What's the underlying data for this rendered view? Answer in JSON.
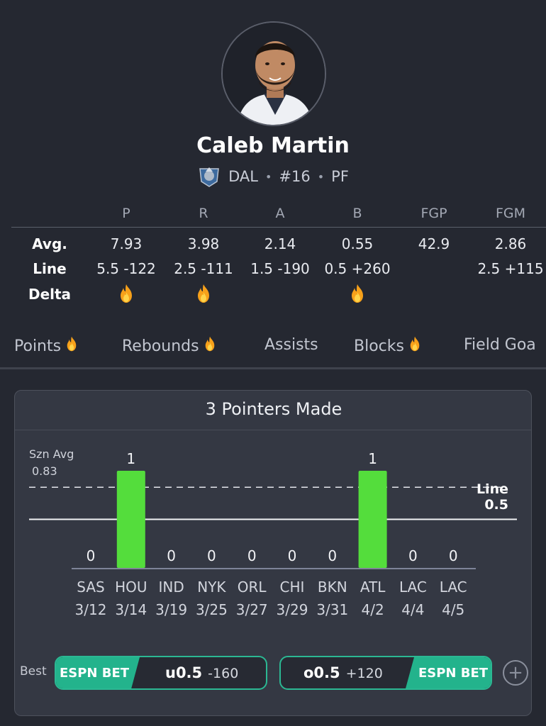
{
  "player": {
    "name": "Caleb Martin",
    "team": "DAL",
    "number": "#16",
    "position": "PF"
  },
  "stats": {
    "columns": [
      "P",
      "R",
      "A",
      "B",
      "FGP",
      "FGM"
    ],
    "rows": {
      "avg": {
        "label": "Avg.",
        "values": [
          "7.93",
          "3.98",
          "2.14",
          "0.55",
          "42.9",
          "2.86"
        ]
      },
      "line": {
        "label": "Line",
        "values": [
          "5.5 -122",
          "2.5 -111",
          "1.5 -190",
          "0.5 +260",
          "",
          "2.5 +115"
        ]
      },
      "delta": {
        "label": "Delta",
        "fire": [
          true,
          true,
          false,
          true,
          false,
          false
        ]
      }
    }
  },
  "tabs": [
    {
      "label": "Points",
      "fire": true
    },
    {
      "label": "Rebounds",
      "fire": true
    },
    {
      "label": "Assists",
      "fire": false
    },
    {
      "label": "Blocks",
      "fire": true
    },
    {
      "label": "Field Goa",
      "fire": false
    }
  ],
  "card": {
    "title": "3 Pointers Made",
    "szn_avg_label": "Szn Avg",
    "szn_avg_value": "0.83",
    "line_label": "Line",
    "line_value": "0.5"
  },
  "chart_data": {
    "type": "bar",
    "title": "3 Pointers Made",
    "categories": [
      {
        "team": "SAS",
        "date": "3/12"
      },
      {
        "team": "HOU",
        "date": "3/14"
      },
      {
        "team": "IND",
        "date": "3/19"
      },
      {
        "team": "NYK",
        "date": "3/25"
      },
      {
        "team": "ORL",
        "date": "3/27"
      },
      {
        "team": "CHI",
        "date": "3/29"
      },
      {
        "team": "BKN",
        "date": "3/31"
      },
      {
        "team": "ATL",
        "date": "4/2"
      },
      {
        "team": "LAC",
        "date": "4/4"
      },
      {
        "team": "LAC",
        "date": "4/5"
      }
    ],
    "values": [
      0,
      1,
      0,
      0,
      0,
      0,
      0,
      1,
      0,
      0
    ],
    "season_average": 0.83,
    "line": 0.5,
    "ylim": [
      0,
      1
    ],
    "colors": {
      "hit": "#54dd3c",
      "axis": "#7e8498"
    }
  },
  "bets": {
    "best_label": "Best",
    "under": {
      "book": "ESPN BET",
      "side": "u0.5",
      "odds": "-160"
    },
    "over": {
      "book": "ESPN BET",
      "side": "o0.5",
      "odds": "+120"
    },
    "add_symbol": "+"
  }
}
